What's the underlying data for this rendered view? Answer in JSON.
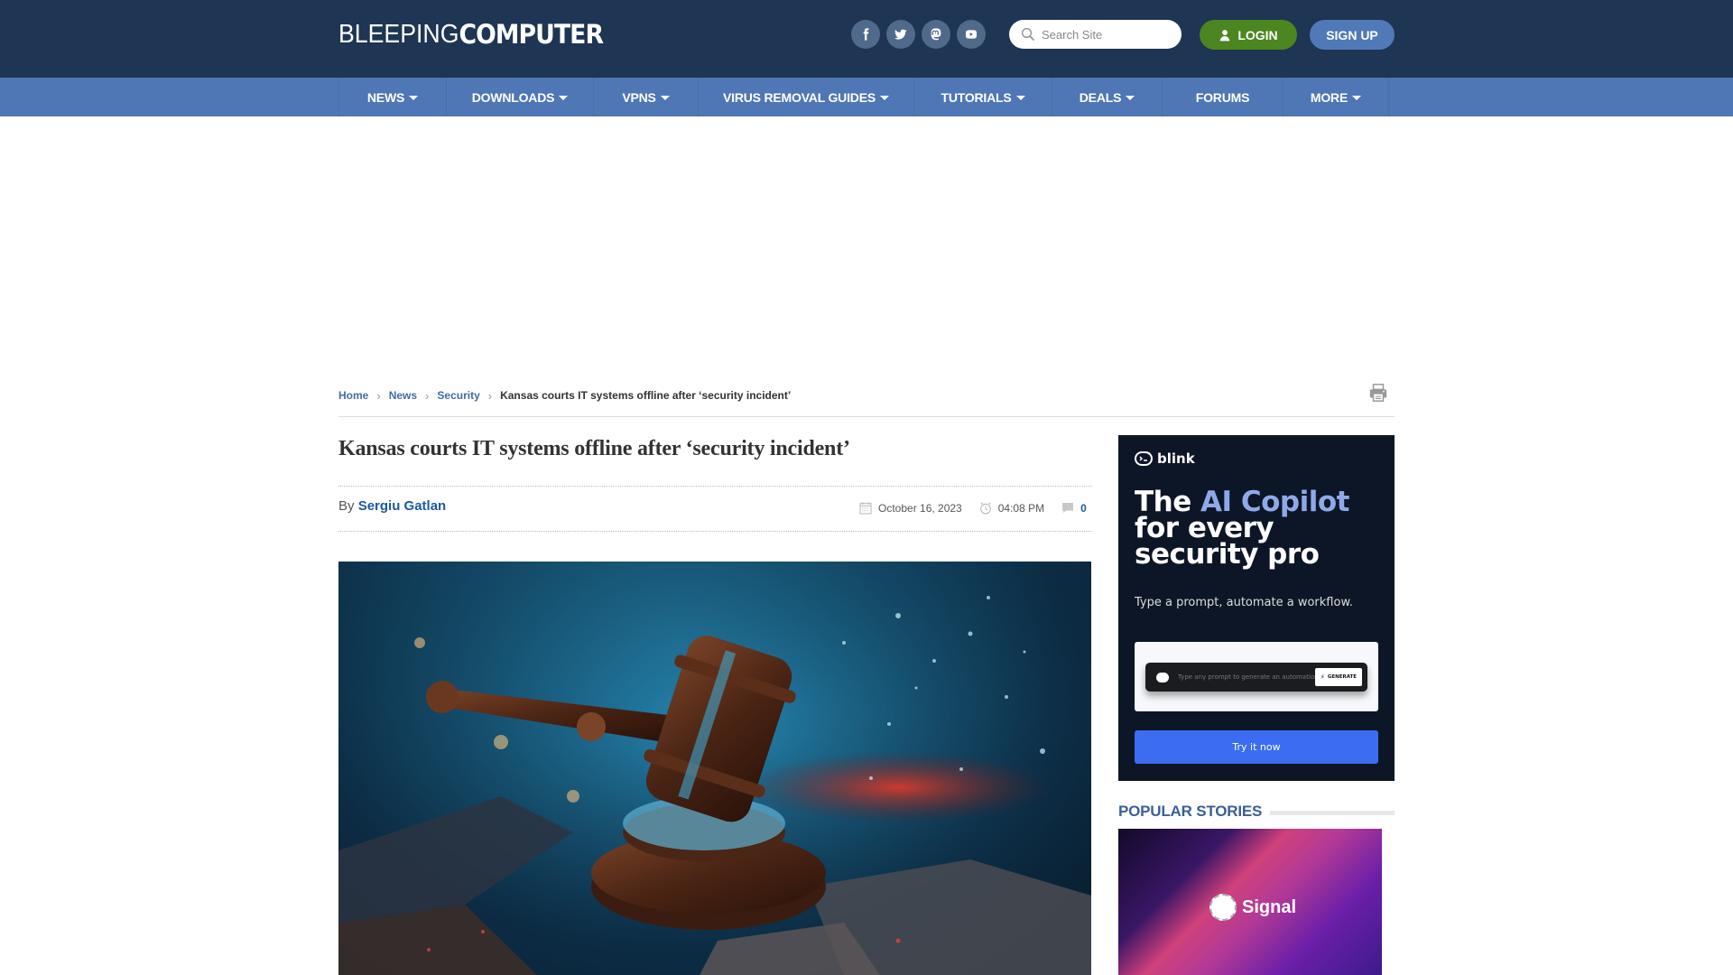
{
  "header": {
    "logo": {
      "light": "BLEEPING",
      "bold": "COMPUTER"
    },
    "social": [
      {
        "name": "facebook",
        "icon": "facebook-icon"
      },
      {
        "name": "twitter",
        "icon": "twitter-icon"
      },
      {
        "name": "mastodon",
        "icon": "mastodon-icon"
      },
      {
        "name": "youtube",
        "icon": "youtube-icon"
      }
    ],
    "search": {
      "placeholder": "Search Site",
      "value": "",
      "icon": "search-icon"
    },
    "login_label": "LOGIN",
    "signup_label": "SIGN UP"
  },
  "nav": {
    "items": [
      {
        "label": "NEWS",
        "dropdown": true
      },
      {
        "label": "DOWNLOADS",
        "dropdown": true
      },
      {
        "label": "VPNS",
        "dropdown": true
      },
      {
        "label": "VIRUS REMOVAL GUIDES",
        "dropdown": true
      },
      {
        "label": "TUTORIALS",
        "dropdown": true
      },
      {
        "label": "DEALS",
        "dropdown": true
      },
      {
        "label": "FORUMS",
        "dropdown": false
      },
      {
        "label": "MORE",
        "dropdown": true
      }
    ]
  },
  "breadcrumb": {
    "items": [
      "Home",
      "News",
      "Security"
    ],
    "current": "Kansas courts IT systems offline after ‘security incident’"
  },
  "article": {
    "title": "Kansas courts IT systems offline after ‘security incident’",
    "by_label": "By",
    "author": "Sergiu Gatlan",
    "date": "October 16, 2023",
    "time": "04:08 PM",
    "comments": "0",
    "hero_alt": "Gavel on shattered surface"
  },
  "ad": {
    "brand": "blink",
    "headline_pre": "The ",
    "headline_accent": "AI Copilot",
    "headline_line2": "for every",
    "headline_line3": "security pro",
    "subtext": "Type a prompt, automate a workflow.",
    "prompt_placeholder": "Type any prompt to generate an automation",
    "generate_label": "GENERATE",
    "cta_label": "Try it now",
    "accent_color": "#8fa9e8",
    "cta_color": "#3b6cf2"
  },
  "sidebar": {
    "popular_heading": "POPULAR STORIES",
    "stories": [
      {
        "image_label": "Signal"
      }
    ]
  },
  "colors": {
    "header_bg": "#1e3553",
    "nav_bg": "#5077b5",
    "login_bg": "#4b8621",
    "signup_bg": "#5079b8",
    "link": "#1a5aa4"
  }
}
